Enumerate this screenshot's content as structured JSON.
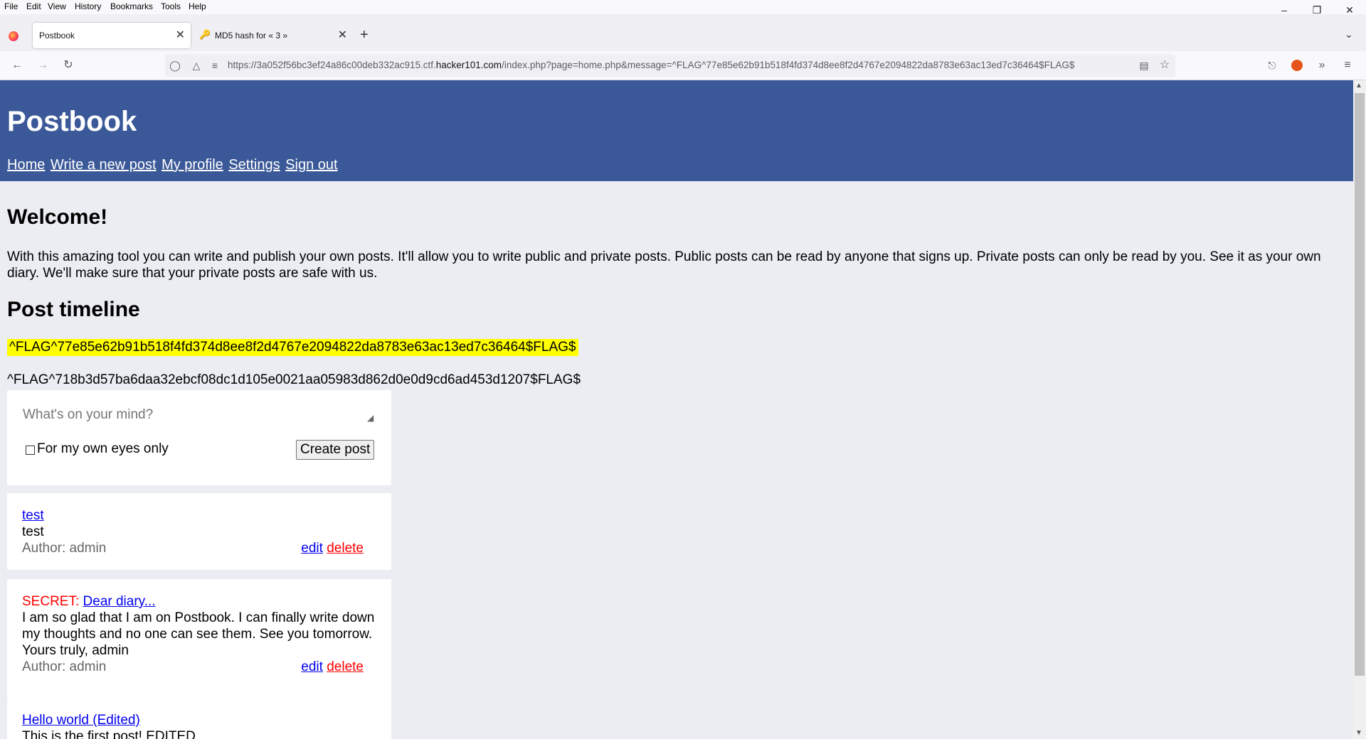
{
  "menu": [
    "File",
    "Edit",
    "View",
    "History",
    "Bookmarks",
    "Tools",
    "Help"
  ],
  "tabs": [
    {
      "title": "Postbook"
    },
    {
      "title": "MD5 hash for « 3 »"
    }
  ],
  "url": {
    "prefix": "https://3a052f56bc3ef24a86c00deb332ac915.ctf.",
    "domain": "hacker101.com",
    "path": "/index.php?page=home.php&message=^FLAG^77e85e62b91b518f4fd374d8ee8f2d4767e2094822da8783e63ac13ed7c36464$FLAG$"
  },
  "site": {
    "brand": "Postbook",
    "nav": [
      "Home",
      "Write a new post",
      "My profile",
      "Settings",
      "Sign out"
    ]
  },
  "main": {
    "welcome": "Welcome!",
    "intro": "With this amazing tool you can write and publish your own posts. It'll allow you to write public and private posts. Public posts can be read by anyone that signs up. Private posts can only be read by you. See it as your own diary. We'll make sure that your private posts are safe with us.",
    "timeline_heading": "Post timeline",
    "message_flag": "^FLAG^77e85e62b91b518f4fd374d8ee8f2d4767e2094822da8783e63ac13ed7c36464$FLAG$",
    "second_flag": "^FLAG^718b3d57ba6daa32ebcf08dc1d105e0021aa05983d862d0e0d9cd6ad453d1207$FLAG$"
  },
  "composer": {
    "placeholder": "What's on your mind?",
    "private_label": "For my own eyes only",
    "submit": "Create post"
  },
  "posts": [
    {
      "title": "test",
      "body": "test",
      "author": "Author: admin",
      "edit": "edit",
      "delete": "delete"
    },
    {
      "secret": "SECRET:",
      "title": "Dear diary...",
      "body": "I am so glad that I am on Postbook. I can finally write down my thoughts and no one can see them. See you tomorrow. Yours truly, admin",
      "author": "Author: admin",
      "edit": "edit",
      "delete": "delete"
    },
    {
      "title": "Hello world (Edited)",
      "body": "This is the first post! EDITED"
    }
  ]
}
